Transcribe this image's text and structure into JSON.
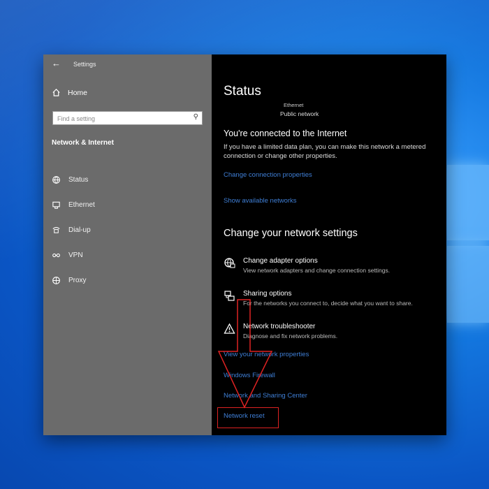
{
  "window": {
    "title": "Settings"
  },
  "sidebar": {
    "home_label": "Home",
    "search_placeholder": "Find a setting",
    "section_title": "Network & Internet",
    "items": [
      {
        "label": "Status",
        "icon": "globe-status-icon"
      },
      {
        "label": "Ethernet",
        "icon": "ethernet-icon"
      },
      {
        "label": "Dial-up",
        "icon": "dialup-icon"
      },
      {
        "label": "VPN",
        "icon": "vpn-icon"
      },
      {
        "label": "Proxy",
        "icon": "proxy-globe-icon"
      }
    ]
  },
  "content": {
    "title": "Status",
    "network_name": "Ethernet",
    "network_type": "Public network",
    "connected_heading": "You're connected to the Internet",
    "connected_desc": "If you have a limited data plan, you can make this network a metered connection or change other properties.",
    "links_top": [
      "Change connection properties",
      "Show available networks"
    ],
    "change_heading": "Change your network settings",
    "options": [
      {
        "title": "Change adapter options",
        "desc": "View network adapters and change connection settings.",
        "icon": "adapter-globe-icon"
      },
      {
        "title": "Sharing options",
        "desc": "For the networks you connect to, decide what you want to share.",
        "icon": "sharing-icon"
      },
      {
        "title": "Network troubleshooter",
        "desc": "Diagnose and fix network problems.",
        "icon": "warning-icon"
      }
    ],
    "links_bottom": [
      "View your network properties",
      "Windows Firewall",
      "Network and Sharing Center",
      "Network reset"
    ]
  },
  "colors": {
    "sidebar_bg": "#6b6b6b",
    "content_bg": "#000000",
    "link": "#3f7fd6",
    "annotation": "#dd2222"
  }
}
